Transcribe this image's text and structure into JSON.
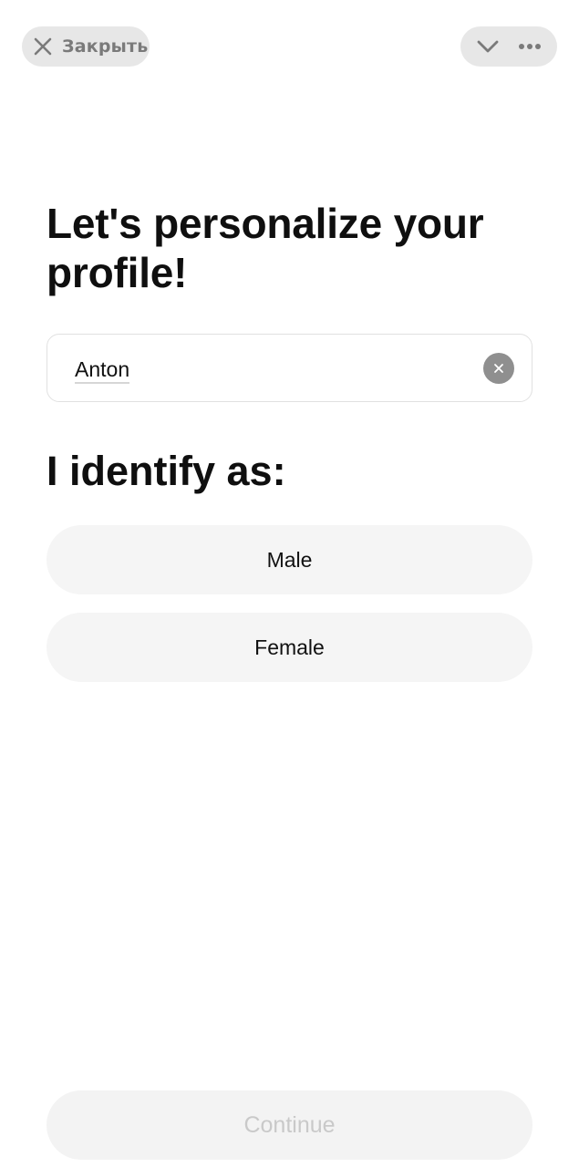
{
  "top_bar": {
    "close_label": "Закрыть",
    "close_icon": "close-icon",
    "collapse_icon": "chevron-down-icon",
    "more_icon": "more-horizontal-icon"
  },
  "main": {
    "title": "Let's personalize your profile!",
    "name_input": {
      "value": "Anton",
      "clear_icon": "clear-icon"
    },
    "identify_heading": "I identify as:",
    "options": [
      {
        "label": "Male"
      },
      {
        "label": "Female"
      }
    ],
    "continue_label": "Continue",
    "continue_enabled": false
  },
  "colors": {
    "background": "#ffffff",
    "pill_background": "#e7e7e7",
    "option_background": "#f5f5f5",
    "disabled_text": "#c9c9c9"
  }
}
